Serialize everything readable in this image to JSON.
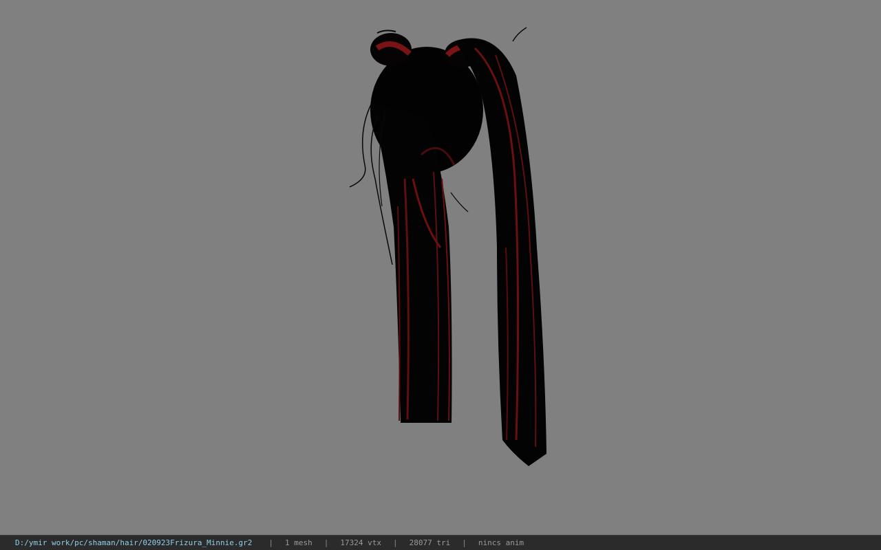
{
  "viewer": {
    "background_color": "#808080",
    "model_icon": "hair-mesh-model"
  },
  "status": {
    "file_path": "D:/ymir work/pc/shaman/hair/020923Frizura_Minnie.gr2",
    "separator": "|",
    "mesh_count": "1 mesh",
    "vertex_count": "17324 vtx",
    "triangle_count": "28077 tri",
    "animation": "nincs anim",
    "path_color": "#8fd0ea",
    "text_color": "#9a9a9a"
  }
}
